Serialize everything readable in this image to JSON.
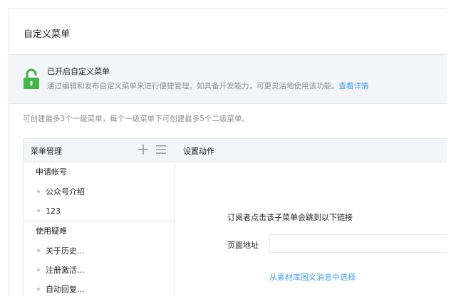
{
  "page": {
    "title": "自定义菜单"
  },
  "notice": {
    "title": "已开启自定义菜单",
    "description": "通过编辑和发布自定义菜单来进行便捷管理，如具备开发能力，可更灵活地使用该功能。",
    "link": "查看详情",
    "icon": "lock-icon",
    "icon_color": "#44b549"
  },
  "limit_text": "可创建最多3个一级菜单，每个一级菜单下可创建最多5个二级菜单。",
  "menu_panel": {
    "title": "菜单管理",
    "add_icon": "plus-icon",
    "sort_icon": "list-icon",
    "groups": [
      {
        "label": "申请帐号",
        "children": [
          "公众号介绍",
          "123"
        ]
      },
      {
        "label": "使用疑难",
        "children": [
          "关于历史...",
          "注册激活...",
          "自动回复..."
        ]
      }
    ]
  },
  "settings_panel": {
    "title": "设置动作",
    "redirect_description": "订阅者点击该子菜单会跳到以下链接",
    "url_label": "页面地址",
    "url_value": "",
    "material_link": "从素材库图文消息中选择"
  },
  "colors": {
    "accent_green": "#44b549",
    "link_blue": "#459ae9",
    "panel_bg": "#f4f5f9"
  }
}
